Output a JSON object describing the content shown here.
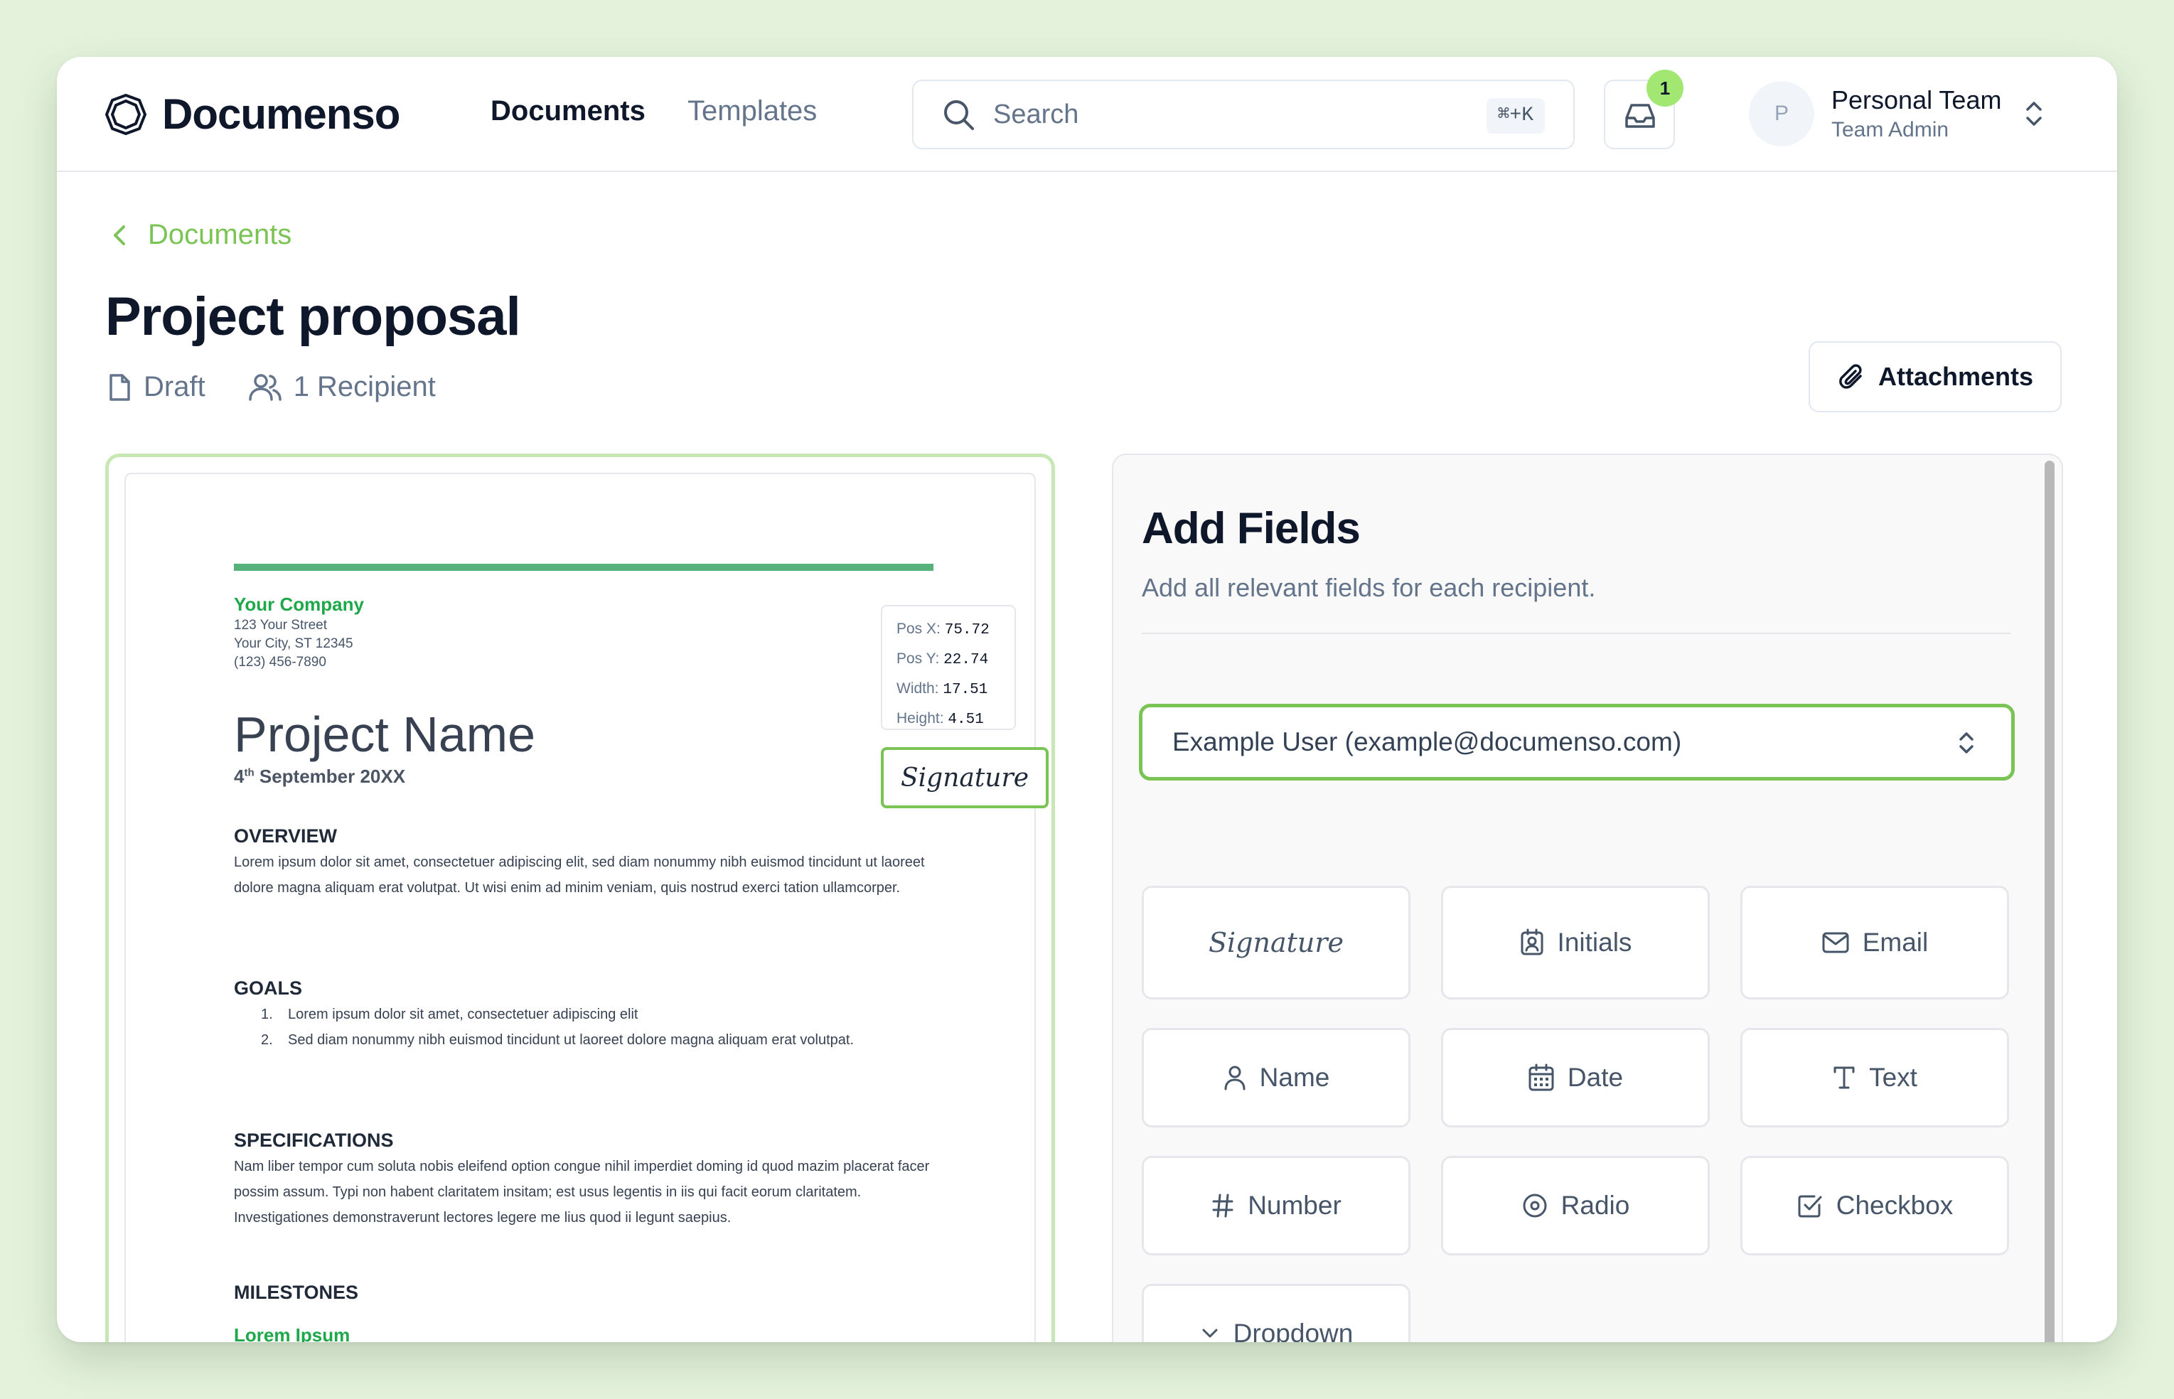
{
  "app": {
    "name": "Documenso"
  },
  "nav": {
    "documents": "Documents",
    "templates": "Templates"
  },
  "search": {
    "placeholder": "Search",
    "shortcut": "⌘+K"
  },
  "inbox": {
    "count": "1"
  },
  "user": {
    "initial": "P",
    "team_name": "Personal Team",
    "role": "Team Admin"
  },
  "breadcrumb": {
    "back_label": "Documents"
  },
  "document": {
    "title": "Project proposal",
    "status": "Draft",
    "recipients": "1 Recipient",
    "attachments_label": "Attachments"
  },
  "preview": {
    "company": "Your Company",
    "address": [
      "123 Your Street",
      "Your City, ST 12345",
      "(123) 456-7890"
    ],
    "heading": "Project Name",
    "date_day": "4",
    "date_suffix": "th",
    "date_rest": " September 20XX",
    "coords": {
      "pos_x_label": "Pos X:",
      "pos_x": "75.72",
      "pos_y_label": "Pos Y:",
      "pos_y": "22.74",
      "width_label": "Width:",
      "width": "17.51",
      "height_label": "Height:",
      "height": "4.51"
    },
    "signature_field": "Signature",
    "overview_title": "OVERVIEW",
    "overview_text": "Lorem ipsum dolor sit amet, consectetuer adipiscing elit, sed diam nonummy nibh euismod tincidunt ut laoreet dolore magna aliquam erat volutpat. Ut wisi enim ad minim veniam, quis nostrud exerci tation ullamcorper.",
    "goals_title": "GOALS",
    "goals": [
      {
        "num": "1.",
        "text": "Lorem ipsum dolor sit amet, consectetuer adipiscing elit"
      },
      {
        "num": "2.",
        "text": "Sed diam nonummy nibh euismod tincidunt ut laoreet dolore magna aliquam erat volutpat."
      }
    ],
    "specs_title": "SPECIFICATIONS",
    "specs_text": "Nam liber tempor cum soluta nobis eleifend option congue nihil imperdiet doming id quod mazim placerat facer possim assum. Typi non habent claritatem insitam; est usus legentis in iis qui facit eorum claritatem. Investigationes demonstraverunt lectores legere me lius quod ii legunt saepius.",
    "milestones_title": "MILESTONES",
    "milestone_first": "Lorem Ipsum"
  },
  "panel": {
    "title": "Add Fields",
    "subtitle": "Add all relevant fields for each recipient.",
    "recipient": "Example User (example@documenso.com)",
    "fields": {
      "signature": "Signature",
      "initials": "Initials",
      "email": "Email",
      "name": "Name",
      "date": "Date",
      "text": "Text",
      "number": "Number",
      "radio": "Radio",
      "checkbox": "Checkbox",
      "dropdown": "Dropdown"
    }
  },
  "colors": {
    "accent": "#7ac455",
    "brand_green": "#1fa84a",
    "badge": "#a2e771",
    "background": "#e4f2dc"
  }
}
